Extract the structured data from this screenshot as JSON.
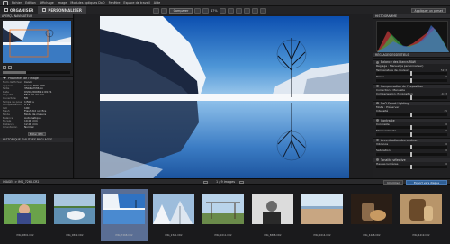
{
  "menu": [
    "Fichier",
    "Edition",
    "Affichage",
    "Image",
    "Modules optiques DxO",
    "Fenêtre",
    "Espace de travail",
    "Aide"
  ],
  "modules": {
    "organize": "ORGANISER",
    "customize": "PERSONNALISER"
  },
  "toolbar": {
    "compare": "Comparer",
    "zoom": "47%",
    "apply_preset": "Appliquer un preset"
  },
  "left": {
    "panel_title": "APERÇU NAVIGATEUR",
    "properties_title": "Propriétés de l'image",
    "properties": [
      {
        "k": "Nom de fichier",
        "v": "Canon"
      },
      {
        "k": "Appareil",
        "v": "Canon EOS 30D"
      },
      {
        "k": "Taille",
        "v": "3504x2336 px"
      },
      {
        "k": "Date",
        "v": "03/02/2008 11:09:21"
      },
      {
        "k": "Objectif",
        "v": "EF-S 10-22 mm"
      },
      {
        "k": "Ouverture",
        "v": "f/8"
      },
      {
        "k": "Temps de pose",
        "v": "1/500 s"
      },
      {
        "k": "Compensation",
        "v": "0 EV"
      },
      {
        "k": "ISO",
        "v": "100"
      },
      {
        "k": "Flash",
        "v": "Flash did not fire"
      },
      {
        "k": "Mode",
        "v": "Mode de mesure"
      },
      {
        "k": "Balance",
        "v": "Automatique"
      },
      {
        "k": "Focale",
        "v": "10.00 mm"
      },
      {
        "k": "Distance",
        "v": "12.00 mm"
      },
      {
        "k": "Orientation",
        "v": "Normal"
      }
    ],
    "edit_button": "Editer IPTC",
    "history_title": "HISTORIQUE D'AUTRES RÉGLAGES"
  },
  "right": {
    "histogram_title": "HISTOGRAMME",
    "tools_title": "RÉGLAGES ESSENTIELS",
    "sections": [
      {
        "title": "Balance des blancs RAW",
        "rows": [
          "Réglage : Manuel (a personnaliser)",
          "Température de couleur",
          "Teinte"
        ],
        "values": [
          "",
          "5173",
          "0"
        ]
      },
      {
        "title": "Compensation de l'exposition",
        "rows": [
          "Correction : Manuelle",
          "Compensation d'exposition"
        ],
        "values": [
          "",
          "-0.33"
        ]
      },
      {
        "title": "DxO Smart Lighting",
        "rows": [
          "Mode : Préserver",
          "Intensité"
        ],
        "values": [
          "",
          "25"
        ]
      },
      {
        "title": "Contraste",
        "rows": [
          "Contraste",
          "Microcontraste"
        ],
        "values": [
          "0",
          "0"
        ]
      },
      {
        "title": "Accentuation des couleurs",
        "rows": [
          "Vibrance",
          "Saturation"
        ],
        "values": [
          "0",
          "0"
        ]
      },
      {
        "title": "Tonalité sélective",
        "rows": [
          "Hautes lumières"
        ],
        "values": [
          "0"
        ]
      }
    ]
  },
  "strip": {
    "path": "IMAGES > IMG_7268.CR2",
    "counter": "1 / 9 images",
    "print": "Imprimer",
    "export": "Export vers disque"
  },
  "filmstrip": [
    {
      "name": "IMG_0801.CR2",
      "sel": false
    },
    {
      "name": "IMG_0842.CR2",
      "sel": false
    },
    {
      "name": "IMG_7268.CR2",
      "sel": true
    },
    {
      "name": "IMG_2321.CR2",
      "sel": false
    },
    {
      "name": "IMG_1011.CR2",
      "sel": false
    },
    {
      "name": "IMG_8808.CR2",
      "sel": false
    },
    {
      "name": "IMG_0214.CR2",
      "sel": false
    },
    {
      "name": "IMG_4428.CR2",
      "sel": false
    },
    {
      "name": "IMG_4419.CR2",
      "sel": false
    }
  ]
}
